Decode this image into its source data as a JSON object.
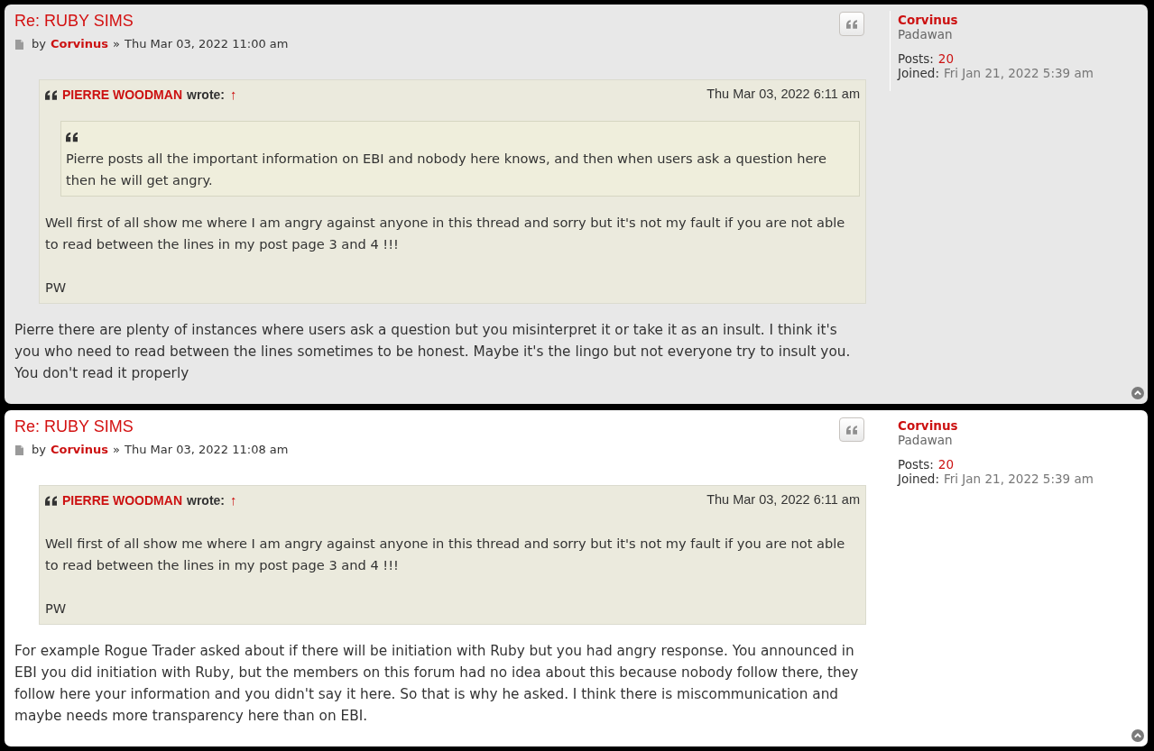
{
  "posts": [
    {
      "shaded": true,
      "title": "Re: RUBY SIMS",
      "byline": {
        "by": "by",
        "author": "Corvinus",
        "separator": "»",
        "date": "Thu Mar 03, 2022 11:00 am"
      },
      "quote": {
        "author": "PIERRE WOODMAN",
        "wrote": "wrote:",
        "link": "↑",
        "date": "Thu Mar 03, 2022 6:11 am",
        "nested_quote": {
          "text": "Pierre posts all the important information on EBI and nobody here knows, and then when users ask a question here then he will get angry."
        },
        "paragraphs": [
          "Well first of all show me where I am angry against anyone in this thread and sorry but it's not my fault if you are not able to read between the lines in my post page 3 and 4 !!!",
          "PW"
        ]
      },
      "body": "Pierre there are plenty of instances where users ask a question but you misinterpret it or take it as an insult. I think it's you who need to read between the lines sometimes to be honest. Maybe it's the lingo but not everyone try to insult you. You don't read it properly",
      "profile": {
        "name": "Corvinus",
        "rank": "Padawan",
        "posts_label": "Posts:",
        "posts": "20",
        "joined_label": "Joined:",
        "joined": "Fri Jan 21, 2022 5:39 am"
      }
    },
    {
      "shaded": false,
      "title": "Re: RUBY SIMS",
      "byline": {
        "by": "by",
        "author": "Corvinus",
        "separator": "»",
        "date": "Thu Mar 03, 2022 11:08 am"
      },
      "quote": {
        "author": "PIERRE WOODMAN",
        "wrote": "wrote:",
        "link": "↑",
        "date": "Thu Mar 03, 2022 6:11 am",
        "paragraphs": [
          "Well first of all show me where I am angry against anyone in this thread and sorry but it's not my fault if you are not able to read between the lines in my post page 3 and 4 !!!",
          "PW"
        ]
      },
      "body": "For example Rogue Trader asked about if there will be initiation with Ruby but you had angry response. You announced in EBI you did initiation with Ruby, but the members on this forum had no idea about this because nobody follow there, they follow here your information and you didn't say it here. So that is why he asked. I think there is miscommunication and maybe needs more transparency here than on EBI.",
      "profile": {
        "name": "Corvinus",
        "rank": "Padawan",
        "posts_label": "Posts:",
        "posts": "20",
        "joined_label": "Joined:",
        "joined": "Fri Jan 21, 2022 5:39 am"
      }
    }
  ]
}
